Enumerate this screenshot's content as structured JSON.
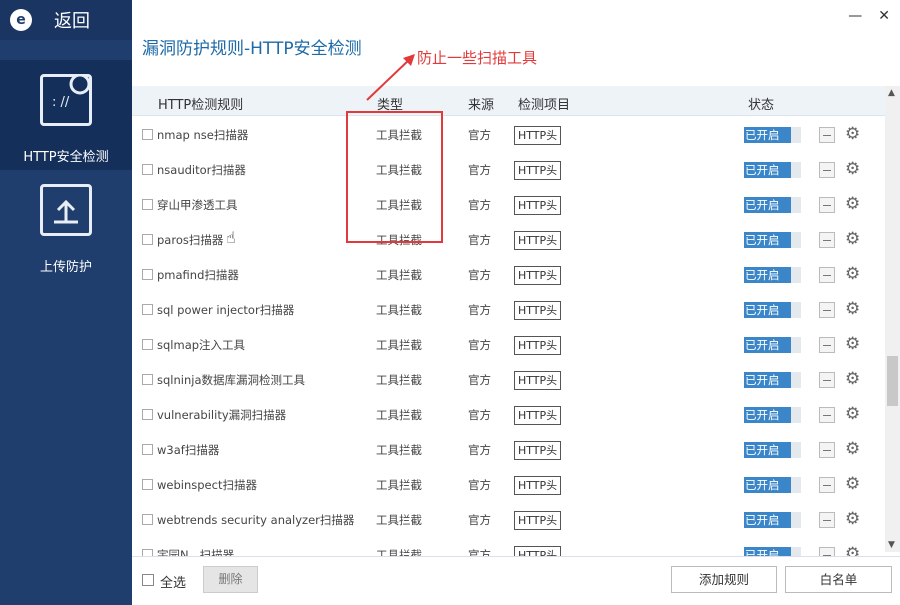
{
  "sidebar": {
    "logo": "e",
    "back_label": "返回",
    "items": [
      {
        "label": "HTTP安全检测",
        "icon": "http-scan-icon",
        "active": true
      },
      {
        "label": "上传防护",
        "icon": "upload-icon",
        "active": false
      }
    ]
  },
  "window": {
    "minimize": "—",
    "close": "✕"
  },
  "header": {
    "title": "漏洞防护规则-HTTP安全检测",
    "annotation": "防止一些扫描工具"
  },
  "table": {
    "columns": [
      "HTTP检测规则",
      "类型",
      "来源",
      "检测项目",
      "状态"
    ],
    "rows": [
      {
        "name": "nmap nse扫描器",
        "type": "工具拦截",
        "source": "官方",
        "item": "HTTP头",
        "status": "已开启"
      },
      {
        "name": "nsauditor扫描器",
        "type": "工具拦截",
        "source": "官方",
        "item": "HTTP头",
        "status": "已开启"
      },
      {
        "name": "穿山甲渗透工具",
        "type": "工具拦截",
        "source": "官方",
        "item": "HTTP头",
        "status": "已开启"
      },
      {
        "name": "paros扫描器",
        "type": "工具拦截",
        "source": "官方",
        "item": "HTTP头",
        "status": "已开启"
      },
      {
        "name": "pmafind扫描器",
        "type": "工具拦截",
        "source": "官方",
        "item": "HTTP头",
        "status": "已开启"
      },
      {
        "name": "sql power injector扫描器",
        "type": "工具拦截",
        "source": "官方",
        "item": "HTTP头",
        "status": "已开启"
      },
      {
        "name": "sqlmap注入工具",
        "type": "工具拦截",
        "source": "官方",
        "item": "HTTP头",
        "status": "已开启"
      },
      {
        "name": "sqlninja数据库漏洞检测工具",
        "type": "工具拦截",
        "source": "官方",
        "item": "HTTP头",
        "status": "已开启"
      },
      {
        "name": "vulnerability漏洞扫描器",
        "type": "工具拦截",
        "source": "官方",
        "item": "HTTP头",
        "status": "已开启"
      },
      {
        "name": "w3af扫描器",
        "type": "工具拦截",
        "source": "官方",
        "item": "HTTP头",
        "status": "已开启"
      },
      {
        "name": "webinspect扫描器",
        "type": "工具拦截",
        "source": "官方",
        "item": "HTTP头",
        "status": "已开启"
      },
      {
        "name": "webtrends security analyzer扫描器",
        "type": "工具拦截",
        "source": "官方",
        "item": "HTTP头",
        "status": "已开启"
      },
      {
        "name": "宇园N...扫描器",
        "type": "工具拦截",
        "source": "官方",
        "item": "HTTP头",
        "status": "已开启"
      }
    ]
  },
  "footer": {
    "select_all": "全选",
    "delete": "删除",
    "add_rule": "添加规则",
    "whitelist": "白名单"
  },
  "colors": {
    "sidebar": "#1f3d6d",
    "sidebar_active": "#14305a",
    "title": "#1e6aa7",
    "status_on": "#3a86c8",
    "annotation": "#e23a3a"
  }
}
